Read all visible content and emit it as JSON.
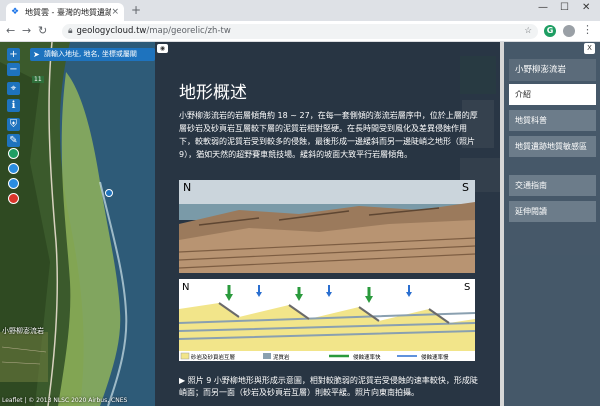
{
  "browser": {
    "tab_title": "地質雲 - 臺灣的地質遺跡",
    "tab_close": "×",
    "new_tab": "+",
    "url_domain": "geologycloud.tw",
    "url_path": "/map/georelic/zh-tw",
    "minimize": "—",
    "maximize": "☐",
    "close": "✕"
  },
  "map": {
    "zoom_in": "+",
    "zoom_out": "−",
    "search_placeholder": "請輸入地址, 地名, 坐標或屬關",
    "road_number": "11",
    "place_label": "小野柳澎流岩",
    "attribution": "Leaflet | © 2013 NLSC 2020 Airbus, CNES"
  },
  "content": {
    "panel_toggle": "◉",
    "title": "地形概述",
    "paragraph": "小野柳澎流岩的岩層傾角約 18 ~ 27，在每一套側傾的澎流岩層序中，位於上層的厚層砂岩及砂頁岩互層較下層的泥質岩相對堅硬。在長時間受到風化及差異侵蝕作用下，較軟弱的泥質岩受到較多的侵蝕，最後形成一邊緩斜而另一邊陡峭之地形（照片9），猶如天然的超野賽車競技場。緩斜的坡面大致平行岩層傾角。",
    "photo_labels": {
      "left": "N",
      "right": "S"
    },
    "diagram_labels": {
      "left": "N",
      "right": "S",
      "legend_sandstone": "砂岩及砂頁岩互層",
      "legend_mudstone": "泥質岩",
      "legend_slow": "侵蝕速率快",
      "legend_fast": "侵蝕速率慢"
    },
    "caption": "▶ 照片 9 小野柳地形與形成示意圖，相對較脆弱的泥質岩受侵蝕的速率較快，形成陡峭面；而另一面（砂岩及砂頁岩互層）則較平緩。照片向東南拍攝。"
  },
  "side_menu": {
    "close": "X",
    "title": "小野柳澎流岩",
    "items": [
      {
        "label": "介紹"
      },
      {
        "label": "地質科普"
      },
      {
        "label": "地質遺跡地質敏感區"
      },
      {
        "label": "交通指南"
      },
      {
        "label": "延伸閱讀"
      }
    ]
  },
  "colors": {
    "map_button": "#1e73be",
    "content_bg": "#283442",
    "side_bg": "#465868",
    "side_item": "#6c7c8a",
    "active_item": "#ffffff"
  }
}
